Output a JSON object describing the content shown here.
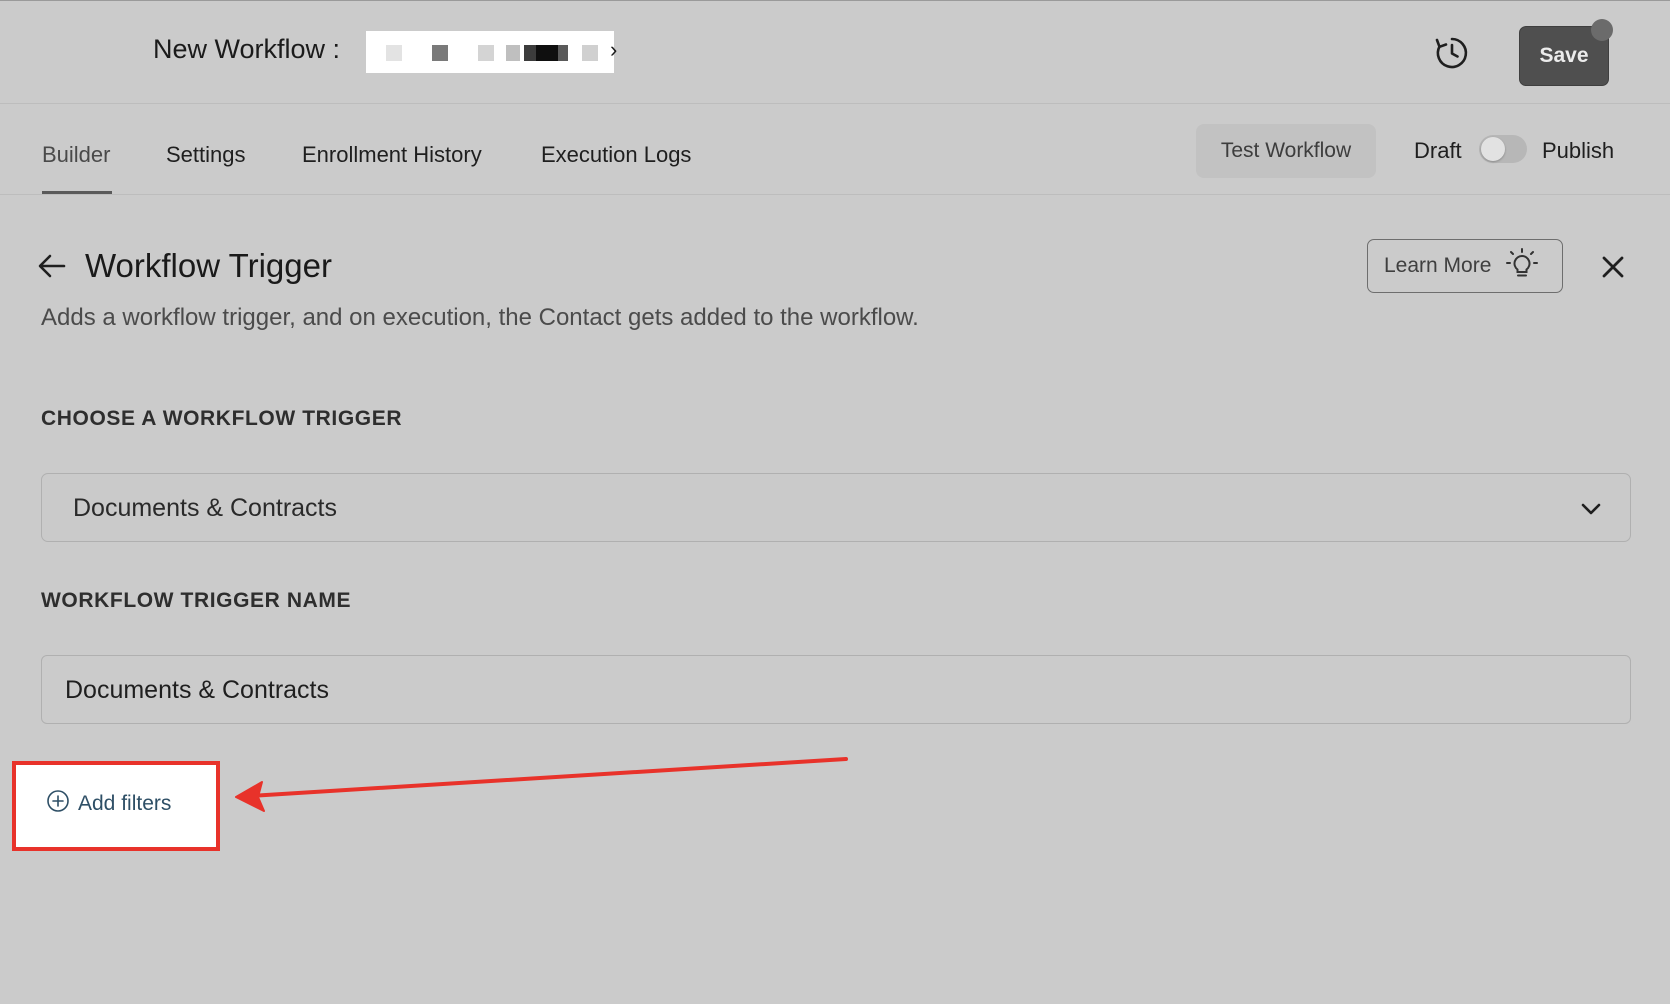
{
  "header": {
    "title_prefix": "New Workflow :",
    "save_label": "Save"
  },
  "tabs": [
    {
      "label": "Builder",
      "active": true
    },
    {
      "label": "Settings",
      "active": false
    },
    {
      "label": "Enrollment History",
      "active": false
    },
    {
      "label": "Execution Logs",
      "active": false
    }
  ],
  "actions": {
    "test_workflow": "Test Workflow",
    "draft_label": "Draft",
    "publish_label": "Publish",
    "publish_toggle_on": false
  },
  "panel": {
    "title": "Workflow Trigger",
    "description": "Adds a workflow trigger, and on execution, the Contact gets added to the workflow.",
    "learn_more": "Learn More",
    "trigger_section_label": "CHOOSE A WORKFLOW TRIGGER",
    "trigger_value": "Documents & Contracts",
    "name_section_label": "WORKFLOW TRIGGER NAME",
    "name_value": "Documents & Contracts",
    "add_filters": "Add filters"
  },
  "colors": {
    "background": "#cbcbcb",
    "save_button": "#4f4f4f",
    "annotation_red": "#e8322a",
    "link_blue": "#2e4f66"
  },
  "icons": [
    "history-icon",
    "back-arrow-icon",
    "lightbulb-icon",
    "close-icon",
    "chevron-down-icon",
    "plus-circle-icon"
  ]
}
